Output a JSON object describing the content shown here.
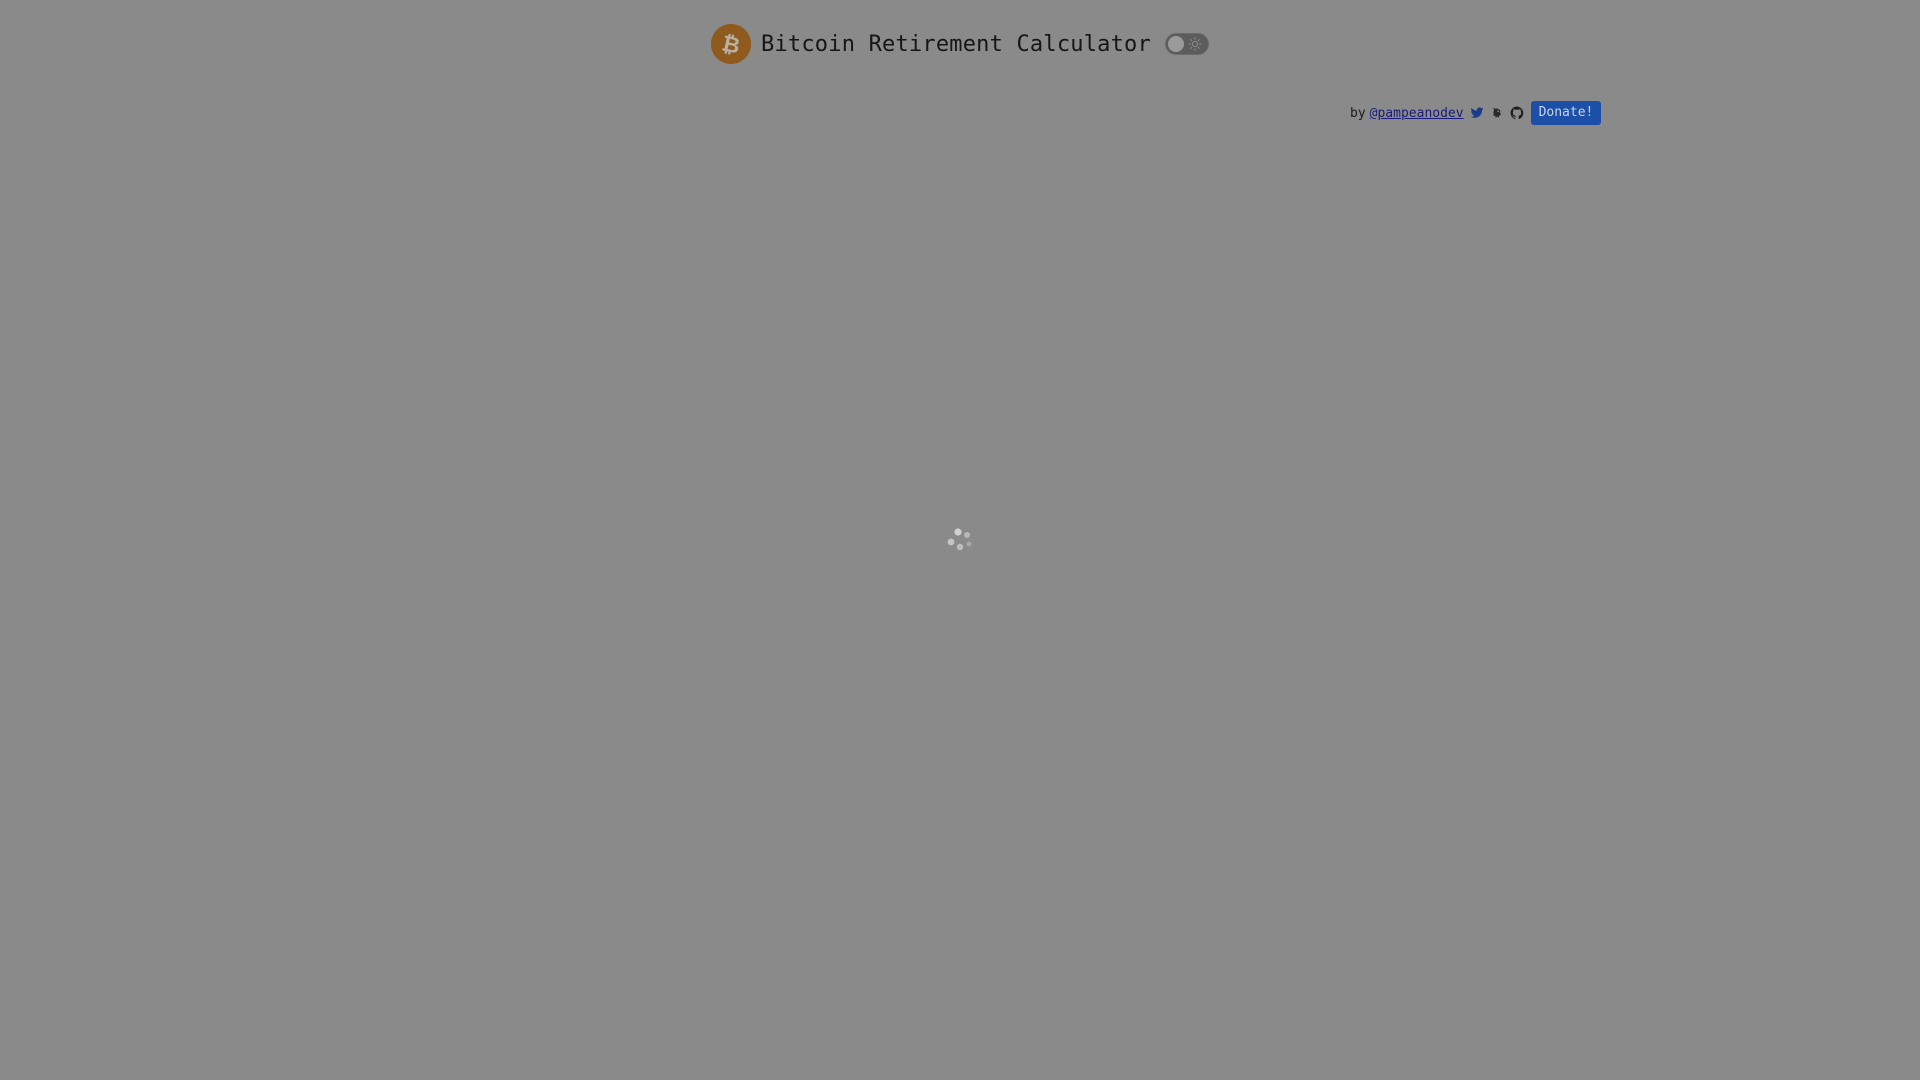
{
  "header": {
    "title": "Bitcoin Retirement Calculator",
    "logo_icon": "bitcoin-icon",
    "theme_toggle_icon": "sun-icon"
  },
  "byline": {
    "prefix": "by",
    "author_link": "@pampeanodev",
    "icons": [
      "twitter-icon",
      "nostr-icon",
      "github-icon"
    ],
    "donate_label": "Donate!"
  },
  "loader": {
    "icon": "loading-spinner-icon"
  },
  "colors": {
    "background": "#8a8a8a",
    "bitcoin": "#8e5a1e",
    "donate": "#1b4fa8",
    "link": "#1a1a7a"
  }
}
